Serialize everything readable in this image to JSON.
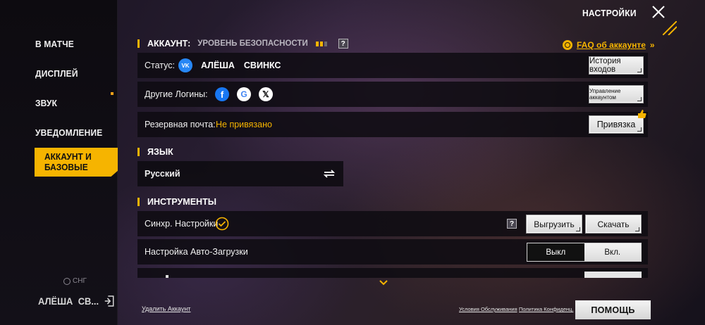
{
  "header": {
    "title": "НАСТРОЙКИ",
    "close_icon": "close-icon"
  },
  "sidebar": {
    "items": [
      {
        "label": "В МАТЧЕ"
      },
      {
        "label": "ДИСПЛЕЙ"
      },
      {
        "label": "ЗВУК"
      },
      {
        "label": "УВЕДОМЛЕНИЕ"
      },
      {
        "label": "АККАУНТ И\nБАЗОВЫЕ",
        "active": true
      }
    ],
    "region": "СНГ",
    "user_name": "АЛЁША",
    "user_short": "СВ..."
  },
  "account": {
    "title": "АККАУНТ:",
    "security_label": "УРОВЕНЬ БЕЗОПАСНОСТИ",
    "security_level": {
      "value": 2,
      "max": 3
    },
    "faq": "FAQ об аккаунте",
    "status_label": "Статус:",
    "status_first": "АЛЁША",
    "status_second": "СВИНКС",
    "history_button": "История входов",
    "other_logins_label": "Другие Логины:",
    "manage_button": "Управление аккаунтом",
    "backup_email_label": "Резервная почта:",
    "backup_email_value": "Не привязано",
    "bind_button": "Привязка"
  },
  "language": {
    "title": "ЯЗЫК",
    "value": "Русский"
  },
  "tools": {
    "title": "ИНСТРУМЕНТЫ",
    "sync_label": "Синхр. Настройки",
    "upload_button": "Выгрузить",
    "download_button": "Скачать",
    "autoload_label": "Настройка Авто-Загрузки",
    "toggle_off": "Выкл",
    "toggle_on": "Вкл."
  },
  "footer": {
    "delete_account": "Удалить Аккаунт",
    "terms": "Условия Обслуживания",
    "privacy": "Политика Конфиденц.",
    "help": "ПОМОЩЬ"
  },
  "colors": {
    "accent": "#f6b400",
    "panel": "#0e0c12"
  }
}
